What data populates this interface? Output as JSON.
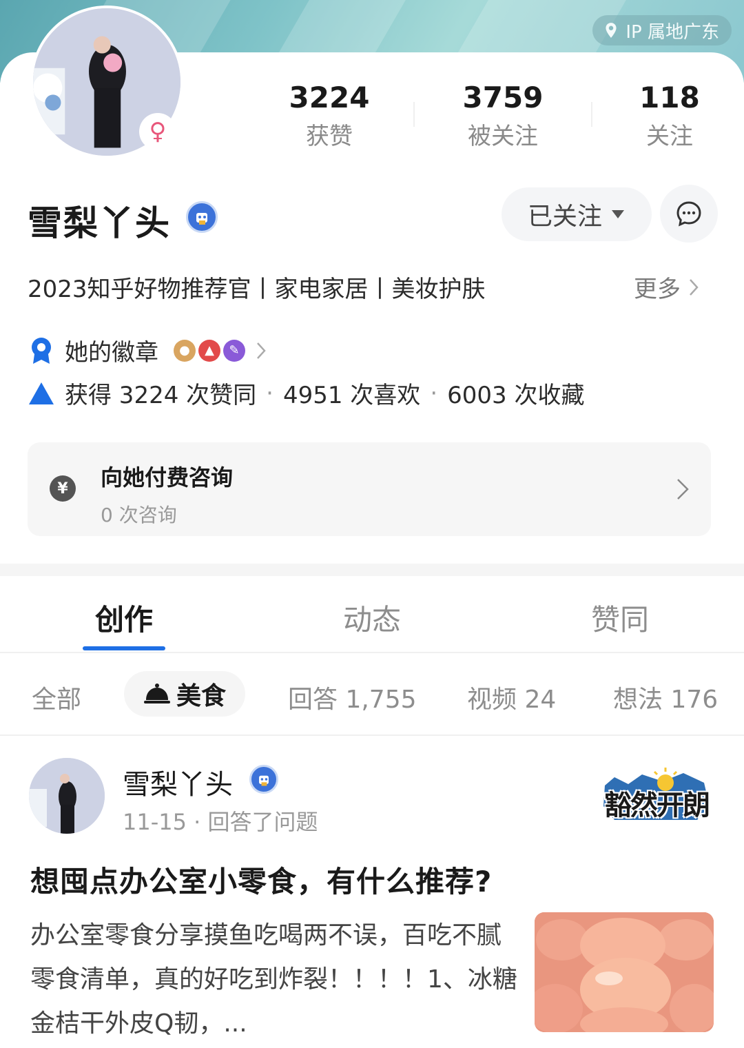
{
  "header": {
    "ip_location": "IP 属地广东"
  },
  "profile": {
    "name": "雪梨丫头",
    "gender_symbol": "♀",
    "stats": [
      {
        "value": "3224",
        "label": "获赞"
      },
      {
        "value": "3759",
        "label": "被关注"
      },
      {
        "value": "118",
        "label": "关注"
      }
    ],
    "follow_label": "已关注",
    "bio": "2023知乎好物推荐官丨家电家居丨美妆护肤",
    "more_label": "更多",
    "badges_label": "她的徽章",
    "achievements": {
      "likes": "获得 3224 次赞同",
      "favorites": "4951 次喜欢",
      "collections": "6003 次收藏",
      "separator": "·"
    },
    "consult": {
      "title": "向她付费咨询",
      "count": "0 次咨询",
      "currency_symbol": "¥"
    }
  },
  "tabs": [
    {
      "label": "创作",
      "active": true
    },
    {
      "label": "动态",
      "active": false
    },
    {
      "label": "赞同",
      "active": false
    }
  ],
  "filters": {
    "all": "全部",
    "food": "美食",
    "answers": "回答 1,755",
    "videos": "视频 24",
    "thoughts": "想法 176"
  },
  "post": {
    "author": "雪梨丫头",
    "meta": "11-15 · 回答了问题",
    "sticker_text": "豁然开朗",
    "title": "想囤点办公室小零食，有什么推荐?",
    "excerpt": "办公室零食分享摸鱼吃喝两不误，百吃不腻零食清单，真的好吃到炸裂！！！！1、冰糖金桔干外皮Q韧，..."
  },
  "colors": {
    "accent": "#1e6fe5",
    "banner": "#7fc3c8",
    "gender": "#e8567a",
    "verify": "#3c72d9"
  }
}
